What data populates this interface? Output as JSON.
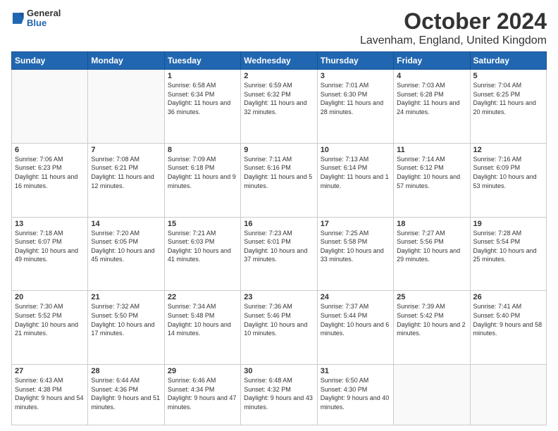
{
  "logo": {
    "general": "General",
    "blue": "Blue"
  },
  "header": {
    "month": "October 2024",
    "location": "Lavenham, England, United Kingdom"
  },
  "days_of_week": [
    "Sunday",
    "Monday",
    "Tuesday",
    "Wednesday",
    "Thursday",
    "Friday",
    "Saturday"
  ],
  "weeks": [
    [
      {
        "day": "",
        "info": ""
      },
      {
        "day": "",
        "info": ""
      },
      {
        "day": "1",
        "info": "Sunrise: 6:58 AM\nSunset: 6:34 PM\nDaylight: 11 hours\nand 36 minutes."
      },
      {
        "day": "2",
        "info": "Sunrise: 6:59 AM\nSunset: 6:32 PM\nDaylight: 11 hours\nand 32 minutes."
      },
      {
        "day": "3",
        "info": "Sunrise: 7:01 AM\nSunset: 6:30 PM\nDaylight: 11 hours\nand 28 minutes."
      },
      {
        "day": "4",
        "info": "Sunrise: 7:03 AM\nSunset: 6:28 PM\nDaylight: 11 hours\nand 24 minutes."
      },
      {
        "day": "5",
        "info": "Sunrise: 7:04 AM\nSunset: 6:25 PM\nDaylight: 11 hours\nand 20 minutes."
      }
    ],
    [
      {
        "day": "6",
        "info": "Sunrise: 7:06 AM\nSunset: 6:23 PM\nDaylight: 11 hours\nand 16 minutes."
      },
      {
        "day": "7",
        "info": "Sunrise: 7:08 AM\nSunset: 6:21 PM\nDaylight: 11 hours\nand 12 minutes."
      },
      {
        "day": "8",
        "info": "Sunrise: 7:09 AM\nSunset: 6:18 PM\nDaylight: 11 hours\nand 9 minutes."
      },
      {
        "day": "9",
        "info": "Sunrise: 7:11 AM\nSunset: 6:16 PM\nDaylight: 11 hours\nand 5 minutes."
      },
      {
        "day": "10",
        "info": "Sunrise: 7:13 AM\nSunset: 6:14 PM\nDaylight: 11 hours\nand 1 minute."
      },
      {
        "day": "11",
        "info": "Sunrise: 7:14 AM\nSunset: 6:12 PM\nDaylight: 10 hours\nand 57 minutes."
      },
      {
        "day": "12",
        "info": "Sunrise: 7:16 AM\nSunset: 6:09 PM\nDaylight: 10 hours\nand 53 minutes."
      }
    ],
    [
      {
        "day": "13",
        "info": "Sunrise: 7:18 AM\nSunset: 6:07 PM\nDaylight: 10 hours\nand 49 minutes."
      },
      {
        "day": "14",
        "info": "Sunrise: 7:20 AM\nSunset: 6:05 PM\nDaylight: 10 hours\nand 45 minutes."
      },
      {
        "day": "15",
        "info": "Sunrise: 7:21 AM\nSunset: 6:03 PM\nDaylight: 10 hours\nand 41 minutes."
      },
      {
        "day": "16",
        "info": "Sunrise: 7:23 AM\nSunset: 6:01 PM\nDaylight: 10 hours\nand 37 minutes."
      },
      {
        "day": "17",
        "info": "Sunrise: 7:25 AM\nSunset: 5:58 PM\nDaylight: 10 hours\nand 33 minutes."
      },
      {
        "day": "18",
        "info": "Sunrise: 7:27 AM\nSunset: 5:56 PM\nDaylight: 10 hours\nand 29 minutes."
      },
      {
        "day": "19",
        "info": "Sunrise: 7:28 AM\nSunset: 5:54 PM\nDaylight: 10 hours\nand 25 minutes."
      }
    ],
    [
      {
        "day": "20",
        "info": "Sunrise: 7:30 AM\nSunset: 5:52 PM\nDaylight: 10 hours\nand 21 minutes."
      },
      {
        "day": "21",
        "info": "Sunrise: 7:32 AM\nSunset: 5:50 PM\nDaylight: 10 hours\nand 17 minutes."
      },
      {
        "day": "22",
        "info": "Sunrise: 7:34 AM\nSunset: 5:48 PM\nDaylight: 10 hours\nand 14 minutes."
      },
      {
        "day": "23",
        "info": "Sunrise: 7:36 AM\nSunset: 5:46 PM\nDaylight: 10 hours\nand 10 minutes."
      },
      {
        "day": "24",
        "info": "Sunrise: 7:37 AM\nSunset: 5:44 PM\nDaylight: 10 hours\nand 6 minutes."
      },
      {
        "day": "25",
        "info": "Sunrise: 7:39 AM\nSunset: 5:42 PM\nDaylight: 10 hours\nand 2 minutes."
      },
      {
        "day": "26",
        "info": "Sunrise: 7:41 AM\nSunset: 5:40 PM\nDaylight: 9 hours\nand 58 minutes."
      }
    ],
    [
      {
        "day": "27",
        "info": "Sunrise: 6:43 AM\nSunset: 4:38 PM\nDaylight: 9 hours\nand 54 minutes."
      },
      {
        "day": "28",
        "info": "Sunrise: 6:44 AM\nSunset: 4:36 PM\nDaylight: 9 hours\nand 51 minutes."
      },
      {
        "day": "29",
        "info": "Sunrise: 6:46 AM\nSunset: 4:34 PM\nDaylight: 9 hours\nand 47 minutes."
      },
      {
        "day": "30",
        "info": "Sunrise: 6:48 AM\nSunset: 4:32 PM\nDaylight: 9 hours\nand 43 minutes."
      },
      {
        "day": "31",
        "info": "Sunrise: 6:50 AM\nSunset: 4:30 PM\nDaylight: 9 hours\nand 40 minutes."
      },
      {
        "day": "",
        "info": ""
      },
      {
        "day": "",
        "info": ""
      }
    ]
  ]
}
